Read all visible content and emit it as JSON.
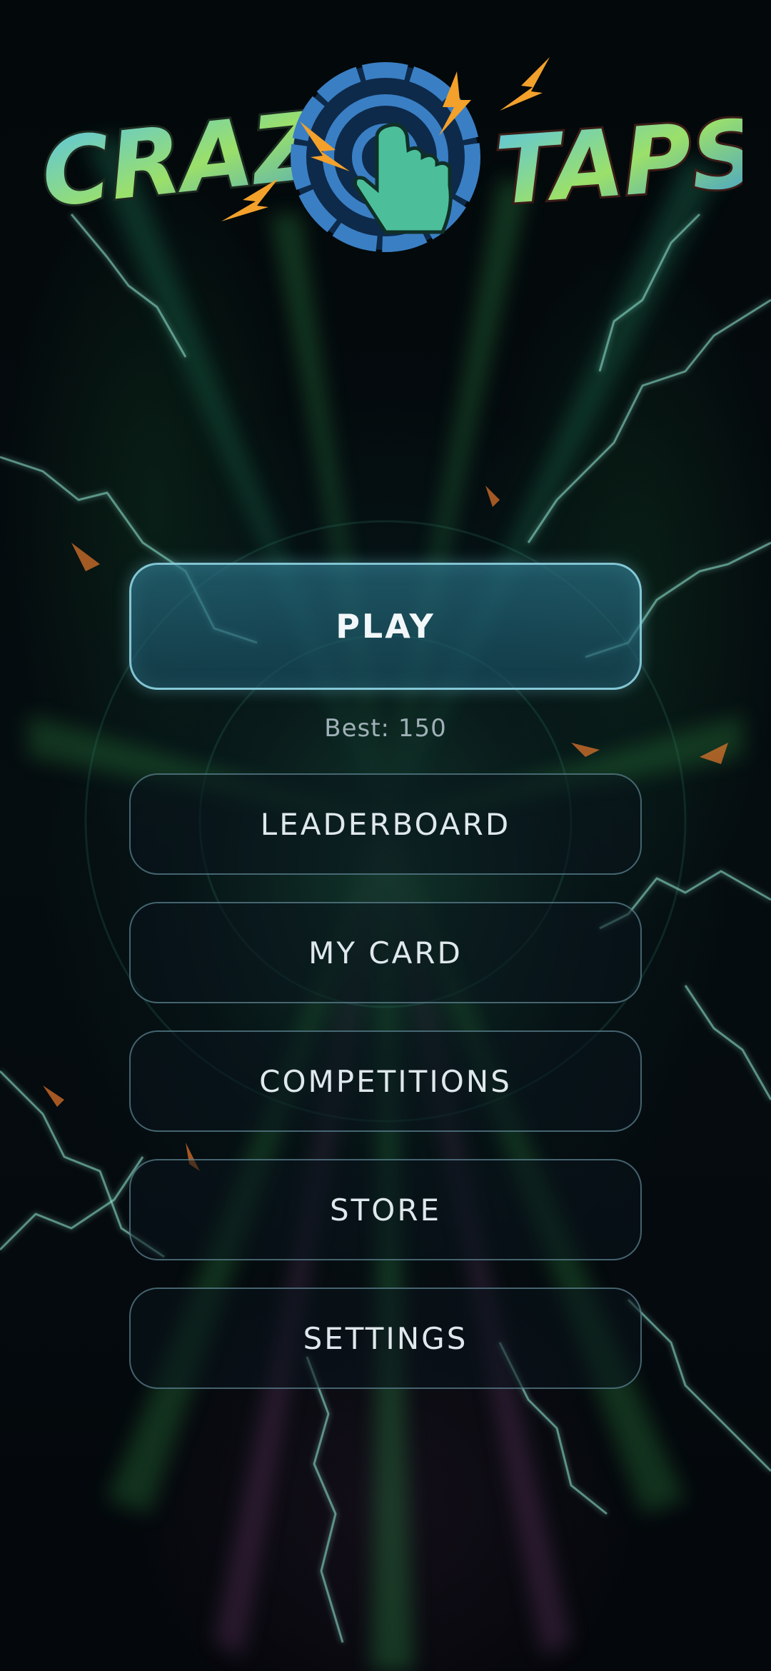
{
  "app": {
    "logo_text_left": "CRAZY",
    "logo_text_right": "TAPS",
    "logo_icon": "tap-target-hand-icon"
  },
  "menu": {
    "play_label": "PLAY",
    "best_score_text": "Best: 150",
    "items": [
      {
        "id": "leaderboard",
        "label": "LEADERBOARD"
      },
      {
        "id": "my-card",
        "label": "MY CARD"
      },
      {
        "id": "competitions",
        "label": "COMPETITIONS"
      },
      {
        "id": "store",
        "label": "STORE"
      },
      {
        "id": "settings",
        "label": "SETTINGS"
      }
    ]
  },
  "colors": {
    "background": "#03080a",
    "play_fill": "#2a6e82",
    "play_border": "#96dceb",
    "button_border": "#78aab9",
    "text": "#e6eef2",
    "best_text": "#9fb0b6",
    "lightning": "#7fe0c8",
    "logo_ring": "#3a7fc4",
    "logo_hand": "#4cbf9a"
  }
}
